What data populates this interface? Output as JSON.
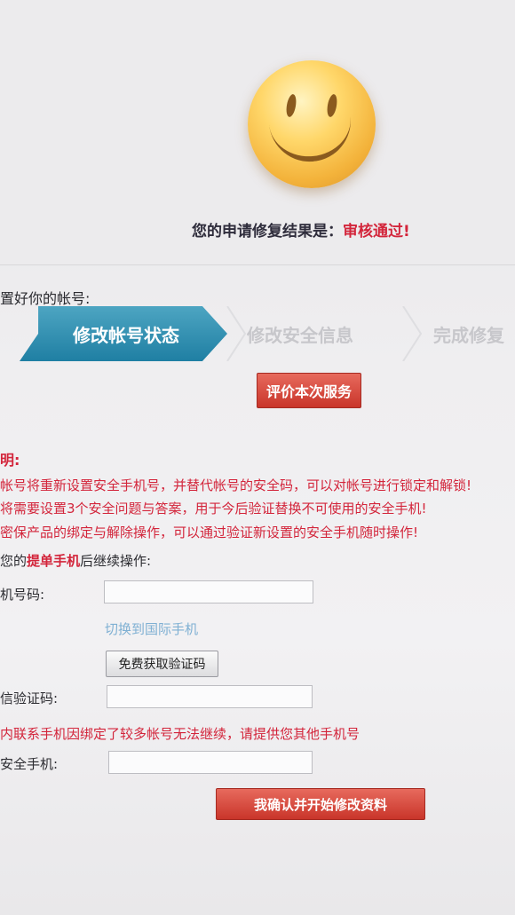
{
  "result": {
    "label": "您的申请修复结果是：",
    "status": "审核通过!"
  },
  "section_title": "置好你的帐号:",
  "steps": [
    {
      "label": "修改帐号状态",
      "active": true
    },
    {
      "label": "修改安全信息",
      "active": false
    },
    {
      "label": "完成修复",
      "active": false
    }
  ],
  "rate_button": "评价本次服务",
  "notes": {
    "title": "明:",
    "lines": [
      "帐号将重新设置安全手机号，并替代帐号的安全码，可以对帐号进行锁定和解锁!",
      "将需要设置3个安全问题与答案，用于今后验证替换不可使用的安全手机!",
      "密保产品的绑定与解除操作，可以通过验证新设置的安全手机随时操作!"
    ]
  },
  "prompt": {
    "before": "您的",
    "highlight": "提单手机",
    "after": "后继续操作:"
  },
  "form": {
    "phone_label": "机号码:",
    "phone_value": "",
    "switch_link": "切换到国际手机",
    "get_code_button": "免费获取验证码",
    "sms_label": "信验证码:",
    "sms_value": "",
    "warning": "内联系手机因绑定了较多帐号无法继续，请提供您其他手机号",
    "secure_label": "安全手机:",
    "secure_value": "",
    "confirm_button": "我确认并开始修改资料"
  },
  "colors": {
    "accent_red": "#d3253b",
    "step_blue": "#1f7fa3",
    "link_blue": "#7fb0d3"
  }
}
